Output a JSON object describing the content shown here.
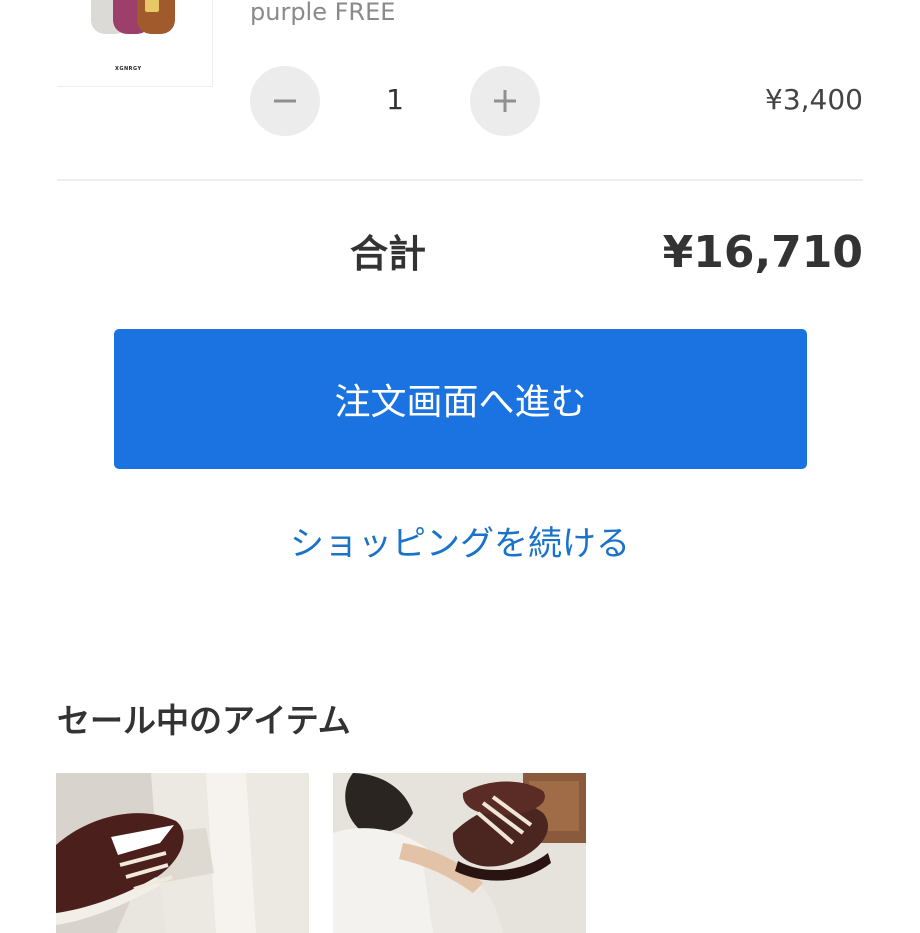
{
  "cart_item": {
    "thumbnail_icon": "product-cap-image",
    "thumbnail_brand": "XGNRGY",
    "variant": "purple FREE",
    "quantity": "1",
    "price": "¥3,400",
    "decrease_icon": "minus-icon",
    "increase_icon": "plus-icon"
  },
  "summary": {
    "total_label": "合計",
    "total_value": "¥16,710"
  },
  "actions": {
    "checkout_label": "注文画面へ進む",
    "continue_label": "ショッピングを続ける"
  },
  "sale_section": {
    "heading": "セール中のアイテム",
    "items": [
      {
        "image_icon": "sneaker-photo"
      },
      {
        "image_icon": "sneaker-photo"
      }
    ]
  },
  "colors": {
    "primary_button": "#1a73e0",
    "link": "#1a73c8",
    "text": "#333333",
    "muted_text": "#8a8a8a",
    "stepper_bg": "#ececec"
  }
}
